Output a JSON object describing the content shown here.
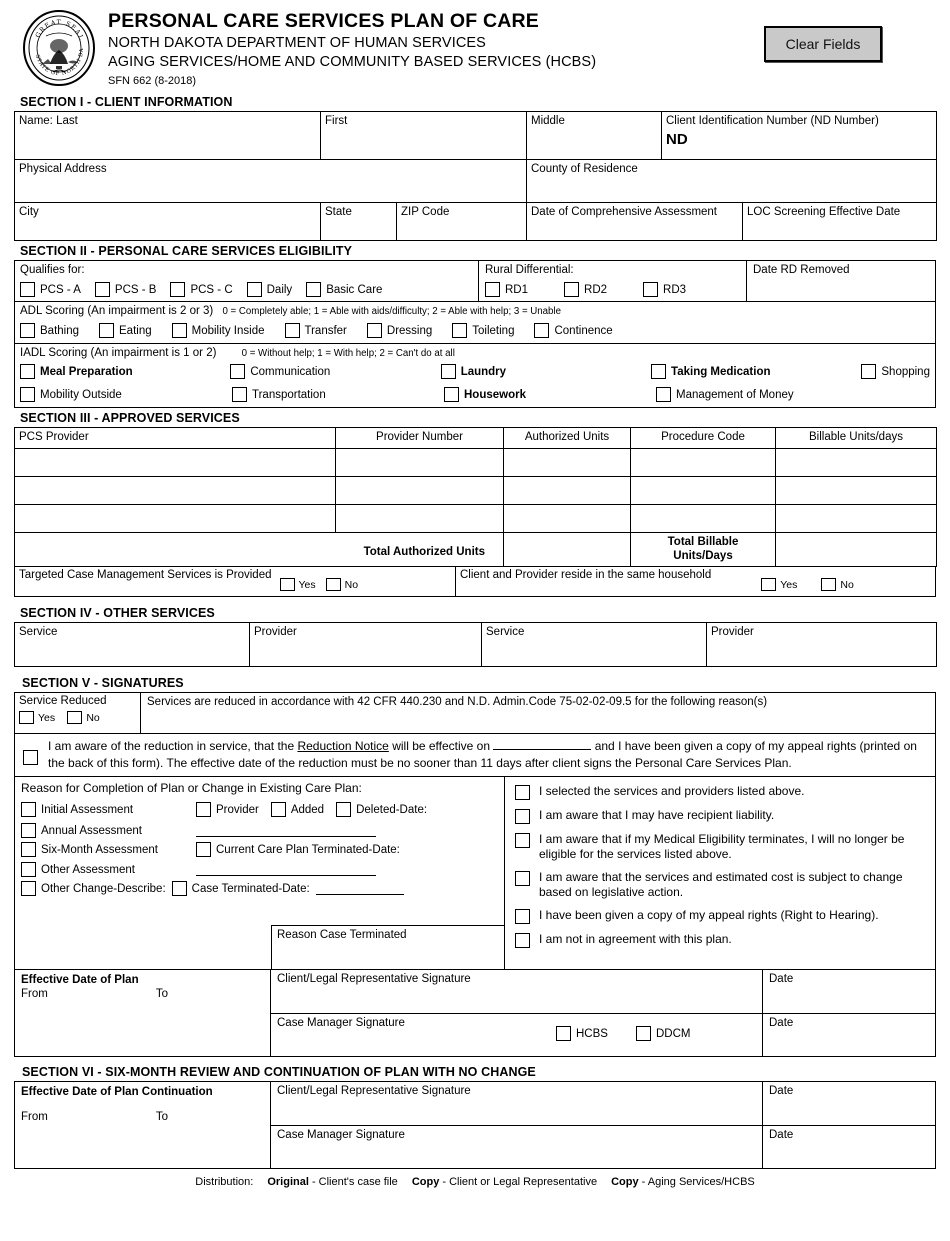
{
  "header": {
    "title": "PERSONAL CARE SERVICES PLAN OF CARE",
    "line2": "NORTH DAKOTA  DEPARTMENT OF HUMAN SERVICES",
    "line3": "AGING SERVICES/HOME AND COMMUNITY BASED SERVICES (HCBS)",
    "form_number": "SFN 662 (8-2018)",
    "clear_button": "Clear Fields",
    "seal": {
      "top_text": "GREAT SEAL",
      "bottom_text": "STATE OF NORTH DAKOTA"
    }
  },
  "section1": {
    "heading": "SECTION I - CLIENT INFORMATION",
    "name_last": "Name:  Last",
    "first": "First",
    "middle": "Middle",
    "client_id": "Client Identification  Number (ND Number)",
    "client_id_prefix": "ND",
    "physical_address": "Physical Address",
    "county": "County of Residence",
    "city": "City",
    "state": "State",
    "zip": "ZIP Code",
    "date_assessment": "Date of Comprehensive Assessment",
    "loc_screening": "LOC Screening Effective Date"
  },
  "section2": {
    "heading": "SECTION II - PERSONAL CARE SERVICES ELIGIBILITY",
    "qualifies_label": "Qualifies for:",
    "qualifies_options": [
      "PCS - A",
      "PCS - B",
      "PCS - C",
      "Daily",
      "Basic Care"
    ],
    "rural_label": "Rural Differential:",
    "rural_options": [
      "RD1",
      "RD2",
      "RD3"
    ],
    "date_rd_removed": "Date RD Removed",
    "adl_heading": "ADL Scoring  (An impairment is 2 or 3)",
    "adl_legend": "0 = Completely able; 1 = Able with aids/difficulty; 2 = Able with help; 3 = Unable",
    "adl_items": [
      "Bathing",
      "Eating",
      "Mobility Inside",
      "Transfer",
      "Dressing",
      "Toileting",
      "Continence"
    ],
    "iadl_heading": "IADL Scoring  (An impairment is 1 or 2)",
    "iadl_legend": "0 = Without help; 1 = With help; 2 = Can't do at all",
    "iadl_row1": [
      {
        "label": "Meal Preparation",
        "bold": true
      },
      {
        "label": "Communication",
        "bold": false
      },
      {
        "label": "Laundry",
        "bold": true
      },
      {
        "label": "Taking Medication",
        "bold": true
      },
      {
        "label": "Shopping",
        "bold": false
      }
    ],
    "iadl_row2": [
      {
        "label": "Mobility Outside",
        "bold": false
      },
      {
        "label": "Transportation",
        "bold": false
      },
      {
        "label": "Housework",
        "bold": true
      },
      {
        "label": "Management of Money",
        "bold": false
      }
    ]
  },
  "section3": {
    "heading": "SECTION III - APPROVED SERVICES",
    "columns": [
      "PCS Provider",
      "Provider Number",
      "Authorized Units",
      "Procedure Code",
      "Billable Units/days"
    ],
    "rows": [
      [
        "",
        "",
        "",
        "",
        ""
      ],
      [
        "",
        "",
        "",
        "",
        ""
      ],
      [
        "",
        "",
        "",
        "",
        ""
      ]
    ],
    "total_authorized_label": "Total Authorized Units",
    "total_authorized_value": "",
    "total_billable_label_line1": "Total Billable",
    "total_billable_label_line2": "Units/Days",
    "total_billable_value": "",
    "tcm_label": "Targeted Case Management Services is Provided",
    "tcm_yes": "Yes",
    "tcm_no": "No",
    "household_label": "Client and Provider reside in the same household",
    "household_yes": "Yes",
    "household_no": "No"
  },
  "section4": {
    "heading": "SECTION IV - OTHER SERVICES",
    "columns": [
      "Service",
      "Provider",
      "Service",
      "Provider"
    ]
  },
  "section5": {
    "heading": "SECTION V - SIGNATURES",
    "service_reduced_label": "Service Reduced",
    "service_reduced_yes": "Yes",
    "service_reduced_no": "No",
    "reduction_statement": "Services are reduced in accordance with 42 CFR 440.230 and N.D. Admin.Code 75-02-02-09.5 for the following reason(s)",
    "aware_part1": "I am aware of  the reduction in service, that the ",
    "aware_notice": "Reduction Notice",
    "aware_part2": " will be effective on ",
    "aware_part3": " and I have been given a copy of my appeal rights (printed on the back of this form).  The effective date of  the reduction must be no sooner than 11 days after client signs the Personal Care Services Plan.",
    "reason_heading": "Reason for Completion of Plan or Change in Existing Care Plan:",
    "reason_left_options": [
      "Initial Assessment",
      "Annual Assessment",
      "Six-Month Assessment",
      "Other Assessment",
      "Other Change-Describe:"
    ],
    "provider_label": "Provider",
    "added_label": "Added",
    "deleted_label": "Deleted-Date:",
    "current_plan_terminated": "Current Care Plan Terminated-Date:",
    "case_terminated": "Case Terminated-Date:",
    "reason_case_terminated": "Reason Case Terminated",
    "attestations": [
      "I selected the services and providers listed above.",
      "I am aware that I may have recipient liability.",
      "I am aware that if my Medical Eligibility terminates, I will no longer be eligible for the services listed above.",
      "I am aware that the services and estimated cost is subject to change based on legislative action.",
      "I have been given a copy of my appeal rights (Right to Hearing).",
      "I am not in agreement with this plan."
    ],
    "effective_date_label": "Effective Date of Plan",
    "from_label": "From",
    "to_label": "To",
    "client_signature": "Client/Legal Representative Signature",
    "date_label": "Date",
    "case_manager_signature": "Case Manager Signature",
    "hcbs_label": "HCBS",
    "ddcm_label": "DDCM"
  },
  "section6": {
    "heading": "SECTION VI - SIX-MONTH REVIEW AND CONTINUATION OF PLAN WITH NO CHANGE",
    "effective_date_label": "Effective Date of Plan Continuation",
    "from_label": "From",
    "to_label": "To",
    "client_signature": "Client/Legal Representative Signature",
    "date_label": "Date",
    "case_manager_signature": "Case Manager Signature"
  },
  "footer": {
    "distribution": "Distribution:",
    "original_bold": "Original",
    "original_rest": "- Client's case file",
    "copy1_bold": "Copy",
    "copy1_rest": "- Client or Legal Representative",
    "copy2_bold": "Copy",
    "copy2_rest": "- Aging Services/HCBS"
  }
}
